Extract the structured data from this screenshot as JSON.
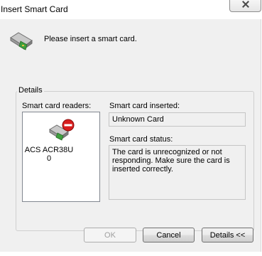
{
  "window": {
    "title": "Insert Smart Card"
  },
  "header": {
    "prompt": "Please insert a smart card."
  },
  "details": {
    "group_label": "Details",
    "readers_label": "Smart card readers:",
    "readers": [
      {
        "name": "ACS ACR38U 0"
      }
    ],
    "inserted_label": "Smart card inserted:",
    "inserted_value": "Unknown Card",
    "status_label": "Smart card status:",
    "status_value": "The card is unrecognized or not responding.  Make sure the card is inserted correctly."
  },
  "buttons": {
    "ok": "OK",
    "cancel": "Cancel",
    "details": "Details <<"
  },
  "icons": {
    "header": "card-reader-icon",
    "reader": "card-reader-error-icon",
    "close": "close-icon"
  }
}
